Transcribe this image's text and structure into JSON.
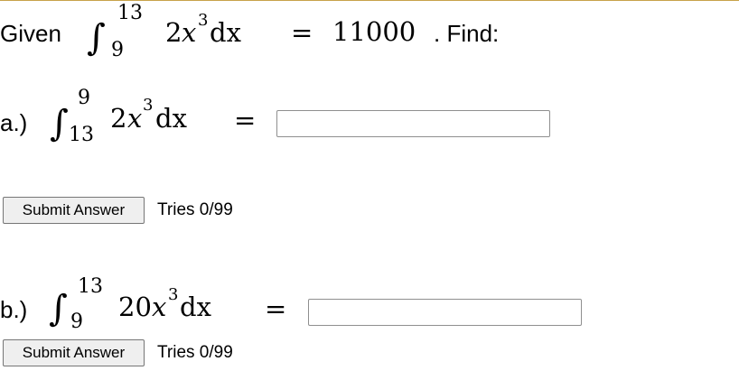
{
  "problem": {
    "given_label": "Given",
    "given_integral": {
      "upper": "13",
      "lower": "9",
      "coefficient": "2",
      "variable": "x",
      "exponent": "3",
      "differential": "dx",
      "equals": "=",
      "value": "11000"
    },
    "find_label": ". Find:"
  },
  "parts": [
    {
      "label": "a.)",
      "integral": {
        "upper": "9",
        "lower": "13",
        "coefficient": "2",
        "variable": "x",
        "exponent": "3",
        "differential": "dx",
        "equals": "="
      },
      "answer_value": "",
      "submit_label": "Submit Answer",
      "tries_text": "Tries 0/99"
    },
    {
      "label": "b.)",
      "integral": {
        "upper": "13",
        "lower": "9",
        "coefficient": "20",
        "variable": "x",
        "exponent": "3",
        "differential": "dx",
        "equals": "="
      },
      "answer_value": "",
      "submit_label": "Submit Answer",
      "tries_text": "Tries 0/99"
    }
  ]
}
